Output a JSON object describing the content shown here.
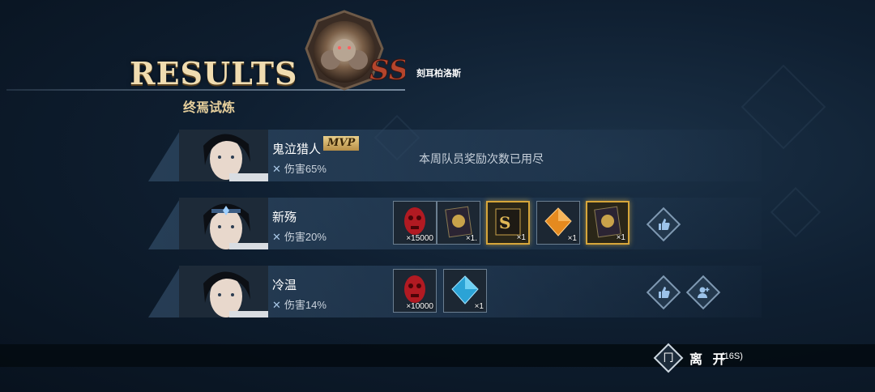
{
  "header": {
    "title": "RESULTS",
    "stage_name": "终焉试炼",
    "boss_name": "刻耳柏洛斯",
    "boss_emblem_text": "SS"
  },
  "players": [
    {
      "name": "鬼泣猎人",
      "mvp_label": "MVP",
      "damage": "伤害65%",
      "reward_status": "本周队员奖励次数已用尽",
      "items": []
    },
    {
      "name": "新殇",
      "damage": "伤害20%",
      "items": [
        {
          "icon": "red-demon-mask-icon",
          "qty": "×15000",
          "rarity": "normal"
        },
        {
          "icon": "gold-emblem-card-icon",
          "qty": "×1.",
          "rarity": "normal"
        },
        {
          "icon": "ss-rank-card-icon",
          "qty": "×1",
          "rarity": "gold"
        },
        {
          "icon": "orange-crystal-icon",
          "qty": "×1",
          "rarity": "normal"
        },
        {
          "icon": "gold-emblem-card-icon",
          "qty": "×1",
          "rarity": "gold"
        }
      ],
      "actions": [
        "like-button"
      ]
    },
    {
      "name": "冷温",
      "damage": "伤害14%",
      "items": [
        {
          "icon": "red-demon-mask-icon",
          "qty": "×10000",
          "rarity": "normal"
        },
        {
          "icon": "blue-crystal-icon",
          "qty": "×1",
          "rarity": "normal"
        }
      ],
      "actions": [
        "like-button",
        "add-friend-button"
      ]
    }
  ],
  "footer": {
    "exit_label": "离 开",
    "exit_timer": "(16S)",
    "exit_icon_glyph": "冂"
  },
  "colors": {
    "gold": "#d7a63a",
    "accent_blue": "#a9c7e6",
    "background": "#0f1f31"
  }
}
